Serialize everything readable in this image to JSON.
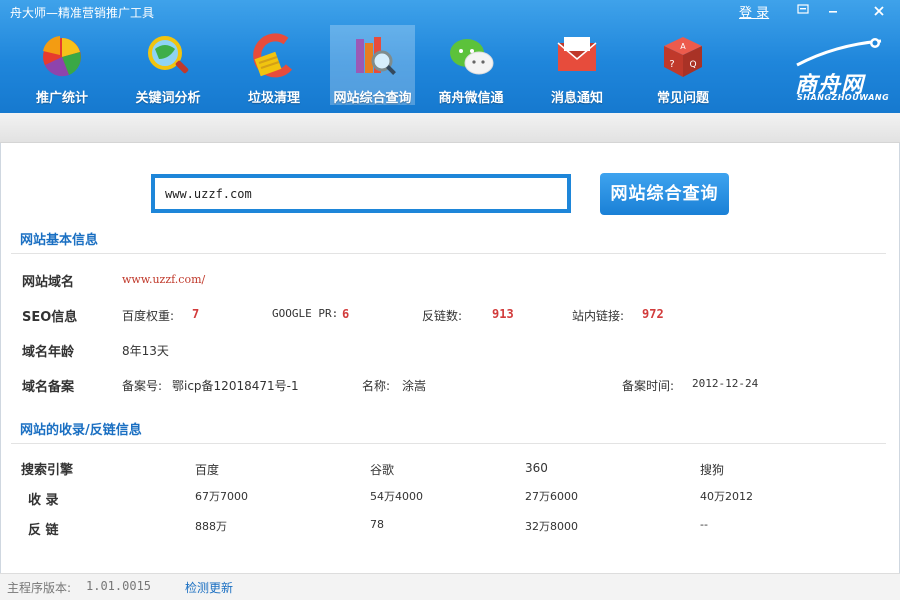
{
  "window": {
    "title": "舟大师—精准营销推广工具",
    "login_label": "登 录",
    "controls": [
      "menu-icon",
      "minimize-icon",
      "close-icon"
    ]
  },
  "toolbar": {
    "items": [
      {
        "label": "推广统计",
        "icon": "pie-chart-icon",
        "active": false
      },
      {
        "label": "关键词分析",
        "icon": "magnifier-globe-icon",
        "active": false
      },
      {
        "label": "垃圾清理",
        "icon": "broom-icon",
        "active": false
      },
      {
        "label": "网站综合查询",
        "icon": "books-search-icon",
        "active": true
      },
      {
        "label": "商舟微信通",
        "icon": "wechat-icon",
        "active": false
      },
      {
        "label": "消息通知",
        "icon": "envelope-icon",
        "active": false
      },
      {
        "label": "常见问题",
        "icon": "faq-cube-icon",
        "active": false
      }
    ],
    "logo": {
      "main": "商舟网",
      "sub": "SHANGZHOUWANG"
    }
  },
  "search": {
    "value": "www.uzzf.com",
    "button_label": "网站综合查询"
  },
  "basic_info": {
    "title": "网站基本信息",
    "domain": {
      "label": "网站域名",
      "value": "www.uzzf.com/"
    },
    "seo": {
      "label": "SEO信息",
      "baidu_weight_label": "百度权重:",
      "baidu_weight_value": "7",
      "pr_label": "GOOGLE PR:",
      "pr_value": "6",
      "backlinks_label": "反链数:",
      "backlinks_value": "913",
      "internal_links_label": "站内链接:",
      "internal_links_value": "972"
    },
    "age": {
      "label": "域名年龄",
      "value": "8年13天"
    },
    "icp": {
      "label": "域名备案",
      "number_label": "备案号:",
      "number_value": "鄂icp备12018471号-1",
      "name_label": "名称:",
      "name_value": "涂嵩",
      "time_label": "备案时间:",
      "time_value": "2012-12-24"
    }
  },
  "index_info": {
    "title": "网站的收录/反链信息",
    "headers": [
      "搜索引擎",
      "百度",
      "谷歌",
      "360",
      "搜狗"
    ],
    "rows": [
      {
        "label": "收 录",
        "values": [
          "67万7000",
          "54万4000",
          "27万6000",
          "40万2012"
        ]
      },
      {
        "label": "反 链",
        "values": [
          "888万",
          "78",
          "32万8000",
          "--"
        ]
      }
    ]
  },
  "status": {
    "version_label": "主程序版本:",
    "version_value": "1.01.0015",
    "update_label": "检测更新"
  }
}
